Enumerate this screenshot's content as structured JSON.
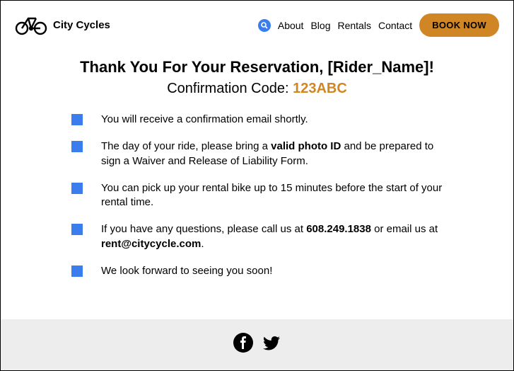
{
  "header": {
    "brand": "City Cycles",
    "nav": {
      "about": "About",
      "blog": "Blog",
      "rentals": "Rentals",
      "contact": "Contact",
      "book": "BOOK NOW"
    }
  },
  "main": {
    "title_pre": "Thank You For Your Reservation, ",
    "title_name": "[Rider_Name]",
    "title_post": "!",
    "subtitle_label": "Confirmation Code: ",
    "confirmation_code": "123ABC",
    "items": {
      "i1": "You will receive a confirmation email shortly.",
      "i2a": "The day of your ride, please bring a ",
      "i2b": "valid photo ID",
      "i2c": " and be prepared to sign a Waiver and Release of Liability Form.",
      "i3": "You can pick up your rental bike up to 15 minutes before the start of your rental time.",
      "i4a": "If you have any questions, please call us at ",
      "i4b": "608.249.1838",
      "i4c": " or email us at ",
      "i4d": "rent@citycycle.com",
      "i4e": ".",
      "i5": "We look forward to seeing you soon!"
    }
  },
  "colors": {
    "accent_blue": "#3b7ded",
    "accent_orange": "#d08624"
  }
}
